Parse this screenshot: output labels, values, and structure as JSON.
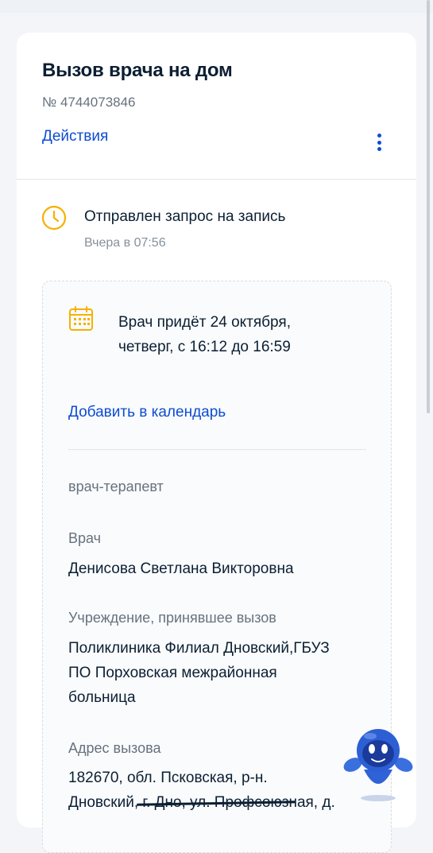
{
  "header": {
    "title": "Вызов врача на дом",
    "number": "№ 4744073846",
    "actions_label": "Действия"
  },
  "status": {
    "text": "Отправлен запрос на запись",
    "time": "Вчера в 07:56",
    "icon": "clock-icon",
    "color": "#f5b100"
  },
  "visit": {
    "icon": "calendar-icon",
    "line1": "Врач придёт 24 октября,",
    "line2": "четверг, с 16:12 до 16:59",
    "add_calendar": "Добавить в календарь"
  },
  "specialty": "врач-терапевт",
  "doctor": {
    "label": "Врач",
    "value": "Денисова Светлана Викторовна"
  },
  "institution": {
    "label": "Учреждение, принявшее вызов",
    "line1": "Поликлиника Филиал Дновский,ГБУЗ",
    "line2": "ПО Порховская межрайонная",
    "line3": "больница"
  },
  "address": {
    "label": "Адрес вызова",
    "line1": "182670, обл. Псковская, р-н.",
    "line2": "Дновский, г. Дно, ул. Профсоюзная, д."
  },
  "colors": {
    "link": "#0d4cd3",
    "text": "#0b1f33",
    "muted": "#66727f"
  }
}
